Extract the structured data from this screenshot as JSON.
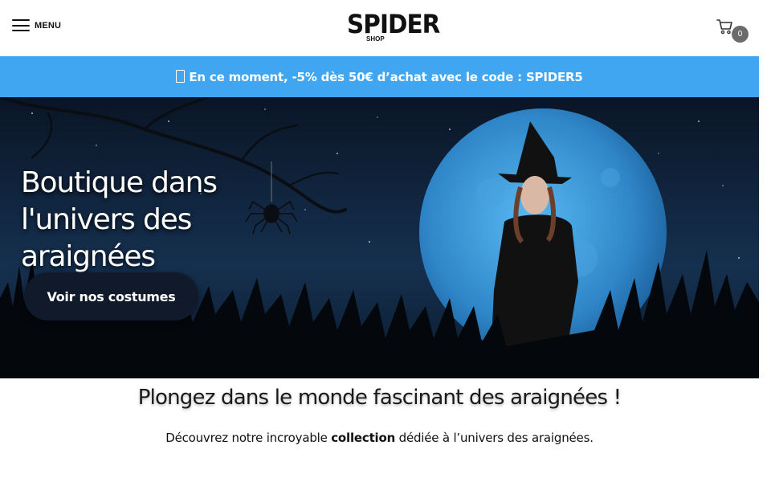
{
  "header": {
    "menu_label": "MENU",
    "logo": {
      "title": "SPIDER",
      "subtitle": "SHOP"
    },
    "cart": {
      "icon": "cart-icon",
      "count": "0"
    }
  },
  "promo": {
    "text": "En ce moment, -5% dès 50€ d’achat avec le code : SPIDER5",
    "icon": "gift-icon"
  },
  "hero": {
    "title": "Boutique dans l'univers des araignées",
    "cta_label": "Voir nos costumes"
  },
  "intro": {
    "title": "Plongez dans le monde fascinant des araignées !",
    "text_before": "Découvrez notre incroyable",
    "text_bold": "collection",
    "text_after": "dédiée à l’univers des araignées."
  },
  "colors": {
    "promo_bar": "#41a6f2",
    "cta_background": "#101a2b",
    "badge": "#6b6b6b"
  }
}
